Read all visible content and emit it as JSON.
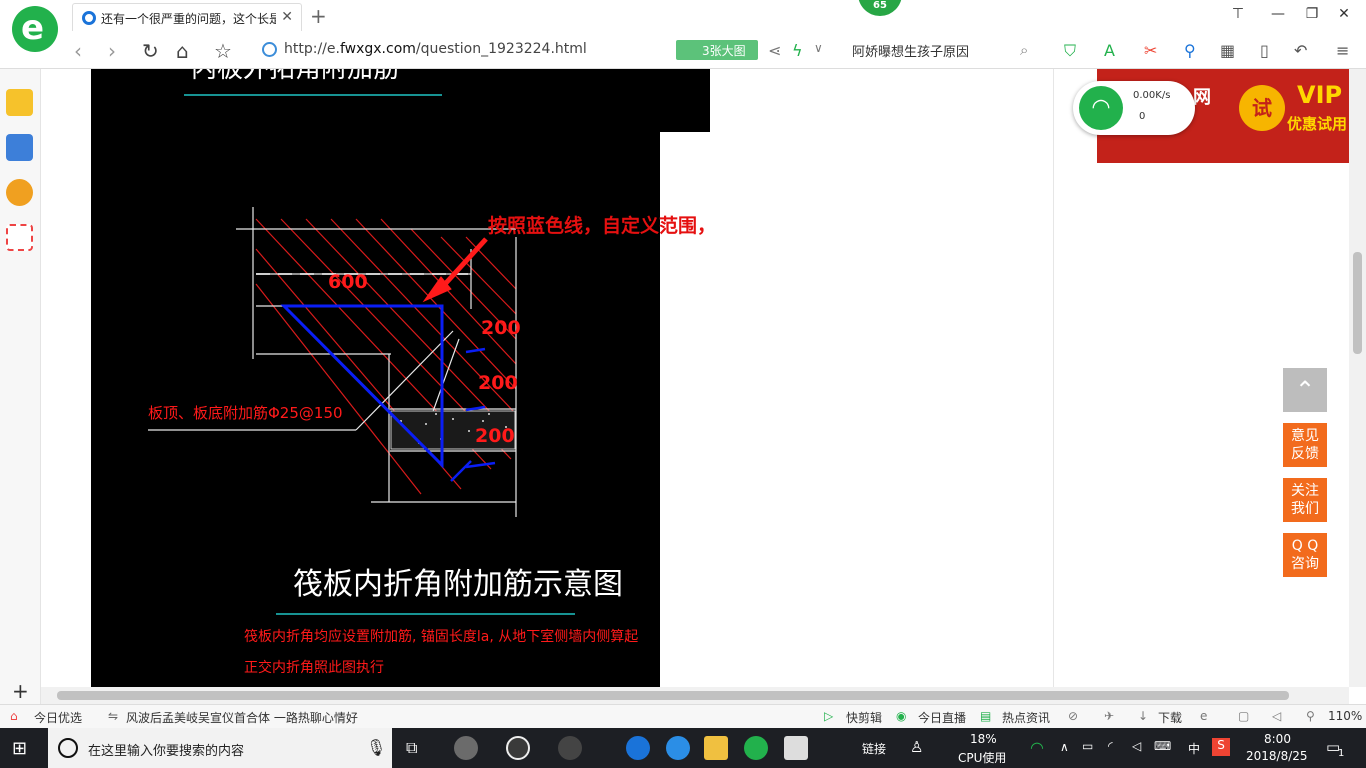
{
  "browser": {
    "badge": "65",
    "tab_title": "还有一个很严重的问题，这个长是",
    "url_prefix": "http://e.",
    "url_domain": "fwxgx.com",
    "url_path": "/question_1923224.html",
    "big_image_button": "3张大图",
    "search_text": "阿娇曝想生孩子原因"
  },
  "drawing": {
    "top_title": "内板外拓角附加筋",
    "callout": "按照蓝色线，自定义范围，平行受力边布置钢筋",
    "dim_top": "600",
    "dims_side": [
      "200",
      "200",
      "200"
    ],
    "rebar_label": "板顶、板底附加筋Φ25@150",
    "main_title": "筏板内折角附加筋示意图",
    "note_line1": "筏板内折角均应设置附加筋, 锚固长度la, 从地下室侧墙内侧算起",
    "note_line2": "正交内折角照此图执行"
  },
  "ad": {
    "net_text": "网",
    "try_text": "试",
    "vip": "VIP",
    "vip_sub": "优惠试用"
  },
  "net_widget": {
    "speed": "0.00K/s",
    "count": "0"
  },
  "side_buttons": {
    "feedback": [
      "意见",
      "反馈"
    ],
    "follow": [
      "关注",
      "我们"
    ],
    "qq": [
      "Q Q",
      "咨询"
    ]
  },
  "statusbar": {
    "today_pick": "今日优选",
    "news": "风波后孟美岐吴宣仪首合体 一路热聊心情好",
    "quick_clip": "快剪辑",
    "today_live": "今日直播",
    "hot_news": "热点资讯",
    "download": "下载",
    "zoom": "110%"
  },
  "taskbar": {
    "search_placeholder": "在这里输入你要搜索的内容",
    "link": "链接",
    "cpu_pct": "18%",
    "cpu_label": "CPU使用",
    "ime": "中",
    "time": "8:00",
    "date": "2018/8/25",
    "notif_count": "1"
  },
  "colors": {
    "brand_green": "#22b14c",
    "ad_red": "#c3221a",
    "side_orange": "#f26b1d",
    "cad_blue": "#0a1ef5",
    "cad_red": "#ff1a1a"
  }
}
